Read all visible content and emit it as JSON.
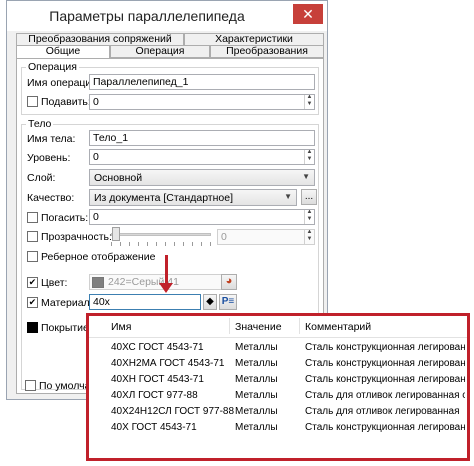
{
  "window": {
    "title": "Параметры параллелепипеда",
    "close_glyph": "✕"
  },
  "tabs": {
    "row1": [
      "Преобразования сопряжений",
      "Характеристики"
    ],
    "row2": [
      "Общие",
      "Операция",
      "Преобразования"
    ]
  },
  "operation_group": {
    "title": "Операция",
    "name_label": "Имя операции:",
    "name_value": "Параллелепипед_1",
    "suppress_label": "Подавить:",
    "suppress_value": "0"
  },
  "body_group": {
    "title": "Тело",
    "name_label": "Имя тела:",
    "name_value": "Тело_1",
    "level_label": "Уровень:",
    "level_value": "0",
    "layer_label": "Слой:",
    "layer_value": "Основной",
    "quality_label": "Качество:",
    "quality_value": "Из документа [Стандартное]",
    "quality_button": "...",
    "extinguish_label": "Погасить:",
    "extinguish_value": "0",
    "transparency_label": "Прозрачность:",
    "transparency_value": "0",
    "transparency_level": 0,
    "edge_display_label": "Реберное отображение",
    "color_label": "Цвет:",
    "color_value": "242=Серый 41",
    "color_swatch": "#808080",
    "material_label": "Материал:",
    "material_value": "40х",
    "material_button": "P≡",
    "coating_label": "Покрытие:",
    "default_label": "По умолча"
  },
  "popup": {
    "headers": [
      "Имя",
      "Значение",
      "Комментарий"
    ],
    "rows": [
      {
        "name": "40ХС ГОСТ 4543-71",
        "value": "Металлы",
        "comment": "Сталь конструкционная легирован..."
      },
      {
        "name": "40ХН2МА ГОСТ 4543-71",
        "value": "Металлы",
        "comment": "Сталь конструкционная легирован..."
      },
      {
        "name": "40ХН ГОСТ 4543-71",
        "value": "Металлы",
        "comment": "Сталь конструкционная легирован..."
      },
      {
        "name": "40ХЛ ГОСТ 977-88",
        "value": "Металлы",
        "comment": "Сталь для отливок легированная с..."
      },
      {
        "name": "40Х24Н12СЛ ГОСТ 977-88",
        "value": "Металлы",
        "comment": "Сталь для отливок легированная"
      },
      {
        "name": "40Х ГОСТ 4543-71",
        "value": "Металлы",
        "comment": "Сталь конструкционная легирован..."
      }
    ]
  },
  "colors": {
    "accent_red": "#c0202a",
    "window_bg": "#f0f0f0"
  }
}
